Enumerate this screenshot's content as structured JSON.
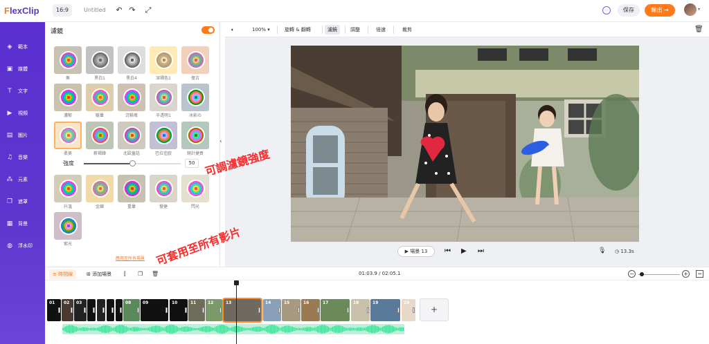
{
  "app": {
    "logo_prefix": "F",
    "logo_rest": "lexClip",
    "aspect_ratio": "16:9",
    "title": "Untitled",
    "save_label": "保存",
    "export_label": "輸出 →"
  },
  "colors": {
    "brand": "#5b2fd1",
    "accent": "#ff7a1a",
    "annotation": "#ff2a2a"
  },
  "nav": [
    {
      "label": "範本",
      "icon": "layers-icon"
    },
    {
      "label": "媒體",
      "icon": "folder-icon"
    },
    {
      "label": "文字",
      "icon": "text-icon"
    },
    {
      "label": "視頻",
      "icon": "video-icon"
    },
    {
      "label": "圖片",
      "icon": "image-icon"
    },
    {
      "label": "音樂",
      "icon": "music-icon"
    },
    {
      "label": "元素",
      "icon": "elements-icon"
    },
    {
      "label": "遮罩",
      "icon": "overlay-icon"
    },
    {
      "label": "背景",
      "icon": "background-icon"
    },
    {
      "label": "浮水印",
      "icon": "watermark-icon"
    }
  ],
  "filter_panel": {
    "title": "濾鏡",
    "enabled": true,
    "intensity_label": "強度",
    "intensity_value": "50",
    "intensity_fraction": 0.5,
    "apply_all_label": "應用至所有場景",
    "filters_row1": [
      "無",
      "黑白1",
      "黑白4",
      "深褐色1",
      "復古"
    ],
    "filters_row2": [
      "濃郁",
      "暖暈",
      "沉積苺",
      "半透明1",
      "冰影の"
    ],
    "filters_row3": [
      "柔美",
      "薪褐韓",
      "北歐童話",
      "巴拉佳欧",
      "銷計捷貢"
    ],
    "filters_row4": [
      "升溫",
      "金鍊",
      "重暈",
      "慢捷",
      "閃光"
    ],
    "filters_row5": [
      "紫光"
    ],
    "selected_filter": "柔美"
  },
  "preview_toolbar": {
    "zoom": "100%",
    "items": [
      "旋轉 & 翻轉",
      "濾鏡",
      "調整",
      "倍速",
      "裁剪"
    ],
    "active": "濾鏡"
  },
  "annotations": {
    "adjust_intensity": "可調濾鏡強度",
    "apply_all": "可套用至所有影片"
  },
  "playback": {
    "scene_label": "▶ 場景 13",
    "duration": "13.3s"
  },
  "timeline": {
    "tab_label": "時間線",
    "add_scene_label": "添加場景",
    "timecode": "01:03.9 / 02:05.1",
    "clips": [
      "01",
      "02",
      "03",
      "",
      "",
      "",
      "",
      "08",
      "09",
      "10",
      "11",
      "12",
      "13",
      "14",
      "15",
      "16",
      "17",
      "18",
      "19",
      "20"
    ],
    "selected_clip": "13",
    "add_label": "+"
  }
}
